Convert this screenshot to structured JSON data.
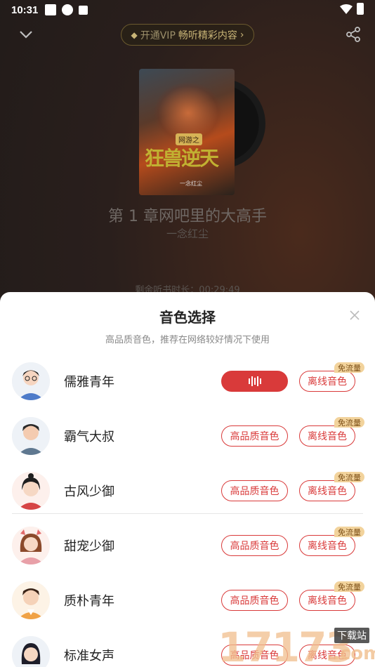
{
  "status_bar": {
    "time": "10:31"
  },
  "top_nav": {
    "vip_prefix": "开通VIP",
    "vip_text": "畅听精彩内容",
    "vip_arrow": "›"
  },
  "cover": {
    "tag": "网游之",
    "title": "狂兽逆天",
    "author": "一念红尘"
  },
  "player": {
    "chapter_title": "第 1 章网吧里的大高手",
    "author": "一念红尘",
    "remaining": "剩余听书时长：00:29:49"
  },
  "sheet": {
    "title": "音色选择",
    "subtitle": "高品质音色，推荐在网络较好情况下使用",
    "free_badge": "免流量",
    "hq_label": "高品质音色",
    "offline_label": "离线音色",
    "voices": [
      {
        "name": "儒雅青年",
        "active": true
      },
      {
        "name": "霸气大叔",
        "active": false
      },
      {
        "name": "古风少御",
        "active": false
      },
      {
        "name": "甜宠少御",
        "active": false
      },
      {
        "name": "质朴青年",
        "active": false
      },
      {
        "name": "标准女声",
        "active": false
      }
    ]
  },
  "watermark": {
    "num": "17173",
    "site": "下载站",
    "com": ".com"
  },
  "colors": {
    "accent": "#d93a3a",
    "badge": "#f2d39c",
    "vip_gold": "#c9b577"
  }
}
